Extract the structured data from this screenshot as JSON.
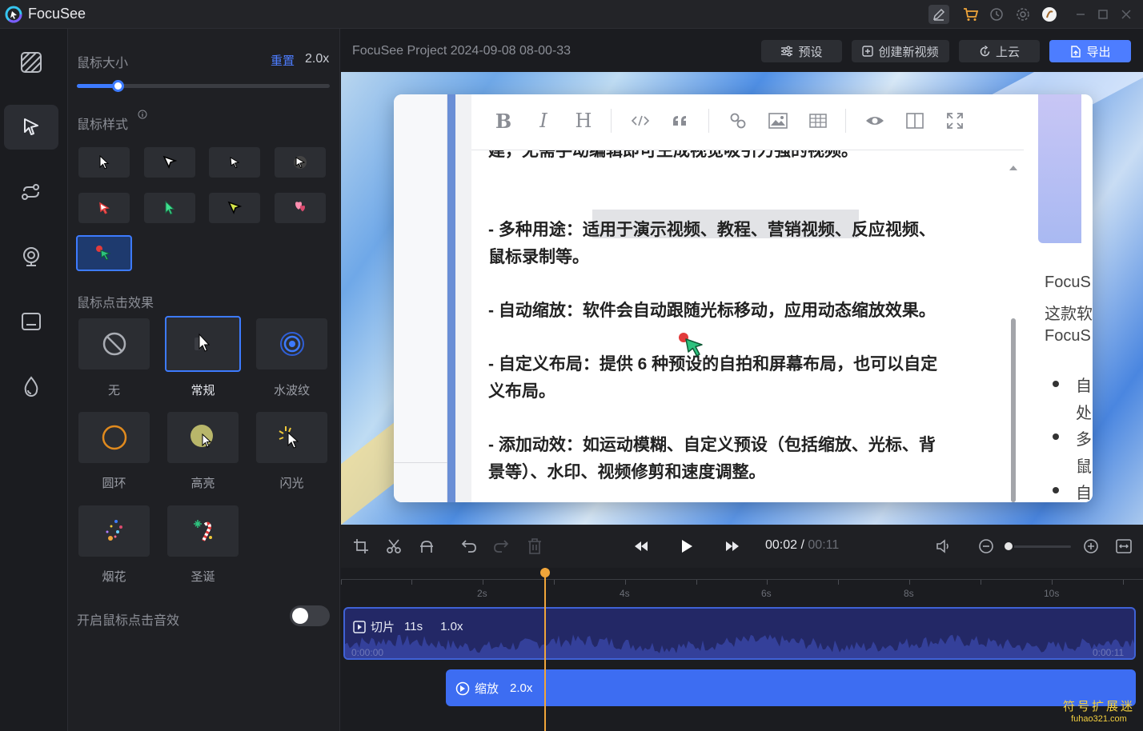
{
  "app": {
    "title": "FocuSee"
  },
  "titlebar_icons": [
    "edit-icon",
    "cart-icon",
    "history-icon",
    "settings-icon",
    "avatar",
    "minimize-icon",
    "maximize-icon",
    "close-icon"
  ],
  "left_rail": [
    "background-pattern-icon",
    "cursor-icon",
    "motion-path-icon",
    "webcam-icon",
    "caption-icon",
    "watermark-drop-icon"
  ],
  "panel": {
    "cursor_size_label": "鼠标大小",
    "reset_label": "重置",
    "cursor_size_value": "2.0x",
    "cursor_size_fraction": 0.16,
    "cursor_style_label": "鼠标样式",
    "click_effect_label": "鼠标点击效果",
    "effects": [
      {
        "label": "无"
      },
      {
        "label": "常规"
      },
      {
        "label": "水波纹"
      },
      {
        "label": "圆环"
      },
      {
        "label": "高亮"
      },
      {
        "label": "闪光"
      },
      {
        "label": "烟花"
      },
      {
        "label": "圣诞"
      }
    ],
    "click_sound_label": "开启鼠标点击音效",
    "click_sound_on": false
  },
  "header": {
    "project_title": "FocuSee Project 2024-09-08 08-00-33",
    "preset_label": "预设",
    "new_video_label": "创建新视频",
    "upload_label": "上云",
    "export_label": "导出"
  },
  "document": {
    "lines": [
      "建，无需手动编辑即可生成视觉吸引力强的视频。",
      "- 多种用途：适用于演示视频、教程、营销视频、反应视频、",
      "鼠标录制等。",
      "- 自动缩放：软件会自动跟随光标移动，应用动态缩放效果。",
      "- 自定义布局：提供 6 种预设的自拍和屏幕布局，也可以自定",
      "义布局。",
      "- 添加动效：如运动模糊、自定义预设（包括缩放、光标、背",
      "景等）、水印、视频修剪和速度调整。"
    ],
    "right_lines": [
      "FocuS",
      "这款软",
      "FocuS"
    ],
    "right_bullets": [
      "自",
      "处",
      "多",
      "鼠",
      "自"
    ]
  },
  "controls": {
    "time_current": "00:02",
    "time_total": "00:11"
  },
  "timeline": {
    "ruler_labels": [
      "2s",
      "4s",
      "6s",
      "8s",
      "10s"
    ],
    "clip_label": "切片",
    "clip_duration": "11s",
    "clip_speed": "1.0x",
    "clip_start": "0:00:00",
    "clip_end": "0:00:11",
    "zoom_label": "缩放",
    "zoom_value": "2.0x"
  },
  "watermark": {
    "line1": "符号扩展迷",
    "line2": "fuhao321.com"
  },
  "colors": {
    "accent": "#3d7bff",
    "export": "#4d7dff",
    "playhead": "#f0a53a",
    "clip": "#232866",
    "zoom_clip": "#3d6df2"
  }
}
